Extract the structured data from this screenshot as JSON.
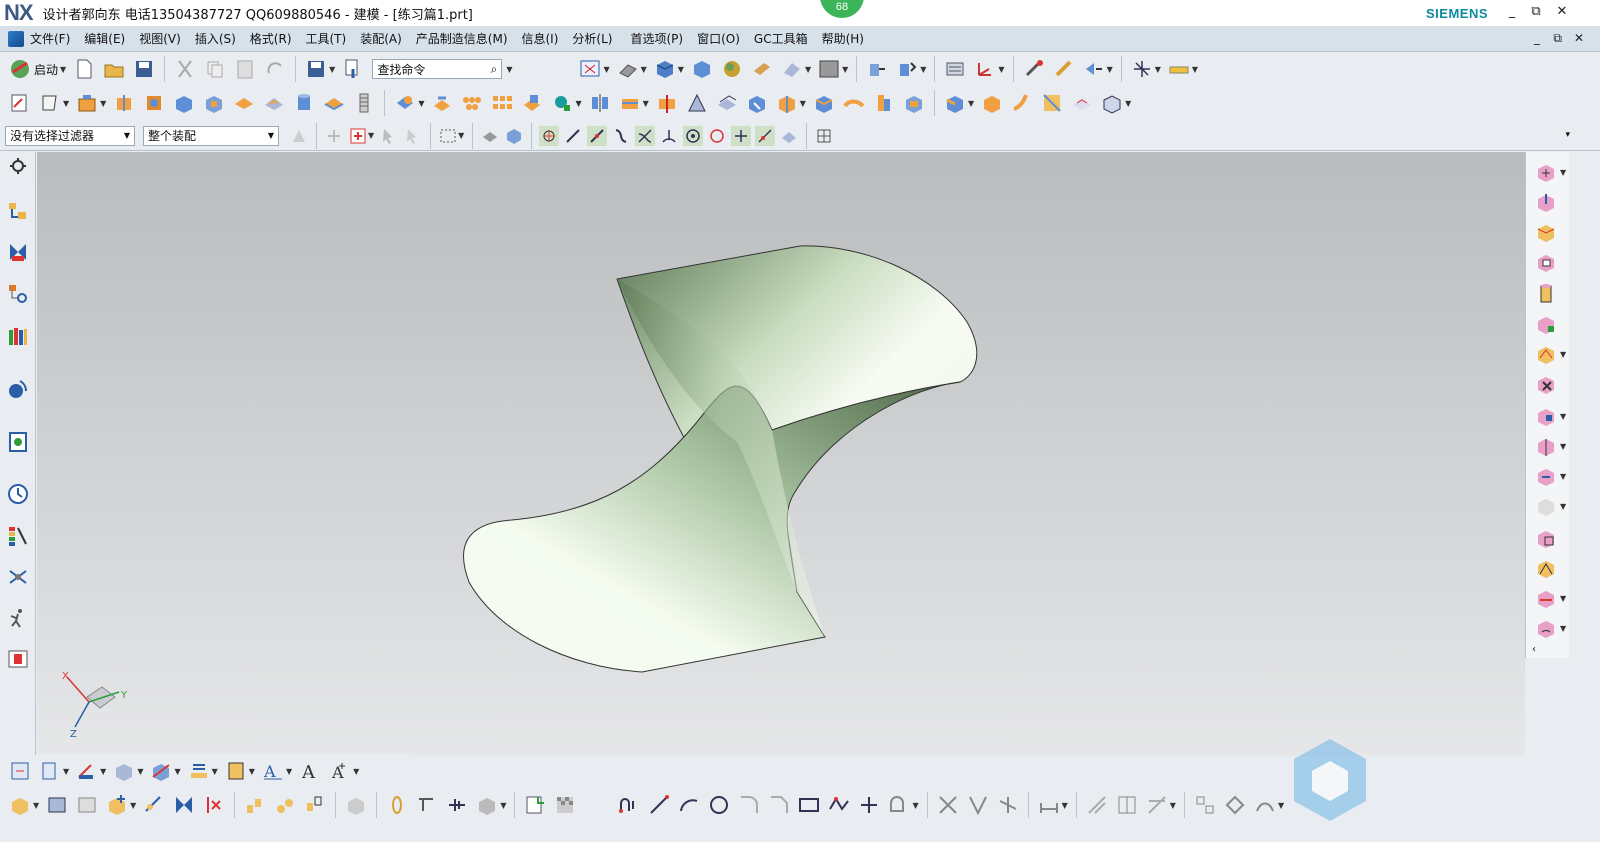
{
  "titlebar": {
    "logo": "NX",
    "title": "设计者郭向东  电话13504387727  QQ609880546 - 建模 - [练习篇1.prt]",
    "badge": "68",
    "brand": "SIEMENS",
    "controls": {
      "minimize": "_",
      "restore": "⧉",
      "close": "✕"
    }
  },
  "menubar": {
    "items": [
      "文件(F)",
      "编辑(E)",
      "视图(V)",
      "插入(S)",
      "格式(R)",
      "工具(T)",
      "装配(A)",
      "产品制造信息(M)",
      "信息(I)",
      "分析(L)",
      "首选项(P)",
      "窗口(O)",
      "GC工具箱",
      "帮助(H)"
    ],
    "controls": {
      "minimize": "_",
      "restore": "⧉",
      "close": "✕"
    }
  },
  "toolbar1": {
    "start_label": "启动",
    "search_placeholder": "查找命令"
  },
  "selection_bar": {
    "filter": "没有选择过滤器",
    "scope": "整个装配"
  },
  "colors": {
    "accent": "#3cb45a",
    "brand": "#0f8a9d",
    "menubar": "#d7e1ea",
    "surface_light": "#f4fbef",
    "surface_dark": "#566f50"
  },
  "icons": {
    "left": [
      "gear-icon",
      "assembly-navigator-icon",
      "constraint-navigator-icon",
      "part-navigator-icon",
      "reuse-library-icon",
      "hd3d-tools-icon",
      "web-browser-icon",
      "history-icon",
      "system-materials-icon",
      "process-studio-icon",
      "manikin-icon",
      "roles-icon"
    ],
    "right": [
      "move-face-icon",
      "pull-face-icon",
      "offset-region-icon",
      "replace-face-icon",
      "resize-blend-icon",
      "resize-chamfer-icon",
      "label-notch-blend-icon",
      "delete-face-icon",
      "copy-face-icon",
      "paste-face-icon",
      "mirror-face-icon",
      "pattern-face-icon",
      "group-face-icon",
      "make-coplanar-icon",
      "linear-dimension-icon",
      "angular-dimension-icon"
    ]
  }
}
